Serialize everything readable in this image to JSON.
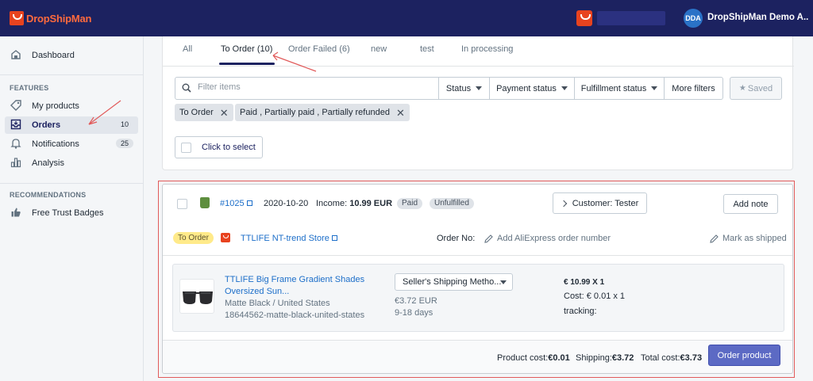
{
  "header": {
    "logo_text": "DropShipMan",
    "avatar_initials": "DDA",
    "store_name": "DropShipMan Demo A..."
  },
  "sidebar": {
    "dashboard": "Dashboard",
    "features_title": "FEATURES",
    "items": [
      {
        "label": "My products",
        "icon": "tag-icon"
      },
      {
        "label": "Orders",
        "icon": "inbox-icon",
        "count": "10",
        "active": true
      },
      {
        "label": "Notifications",
        "icon": "bell-icon",
        "count": "25"
      },
      {
        "label": "Analysis",
        "icon": "bar-chart-icon"
      }
    ],
    "recommendations_title": "RECOMMENDATIONS",
    "trust_badges": "Free Trust Badges"
  },
  "tabs": [
    "All",
    "To Order (10)",
    "Order Failed (6)",
    "new",
    "test",
    "In processing"
  ],
  "filters": {
    "placeholder": "Filter items",
    "status": "Status",
    "payment_status": "Payment status",
    "fulfillment_status": "Fulfillment status",
    "more_filters": "More filters",
    "saved": "Saved",
    "chips": [
      "To Order",
      "Paid , Partially paid , Partially refunded"
    ],
    "click_to_select": "Click to select"
  },
  "order": {
    "number": "#1025",
    "date": "2020-10-20",
    "income_label": "Income:",
    "income_value": "10.99 EUR",
    "payment_badge": "Paid",
    "fulfillment_badge": "Unfulfilled",
    "customer_button": "Customer: Tester",
    "add_note": "Add note",
    "to_order_badge": "To Order",
    "store_name": "TTLIFE NT-trend Store",
    "order_no_label": "Order No:",
    "add_ali_order": "Add AliExpress order number",
    "mark_shipped": "Mark as shipped",
    "product": {
      "title": "TTLIFE Big Frame Gradient Shades Oversized Sun...",
      "variant": "Matte Black / United States",
      "sku": "18644562-matte-black-united-states",
      "shipping_method": "Seller's Shipping Metho...",
      "shipping_price": "€3.72 EUR",
      "shipping_days": "9-18 days",
      "price_qty": "€ 10.99 X 1",
      "cost": "Cost: € 0.01 x 1",
      "tracking": "tracking:"
    },
    "footer": {
      "product_cost_label": "Product cost:",
      "product_cost_value": "€0.01",
      "shipping_label": "Shipping:",
      "shipping_value": "€3.72",
      "total_label": "Total cost:",
      "total_value": "€3.73",
      "order_button": "Order product"
    }
  },
  "colors": {
    "topbar": "#1c2260",
    "brand_orange": "#e8431f",
    "annotation_red": "#e15a5a",
    "primary_button": "#5c6ac4"
  }
}
